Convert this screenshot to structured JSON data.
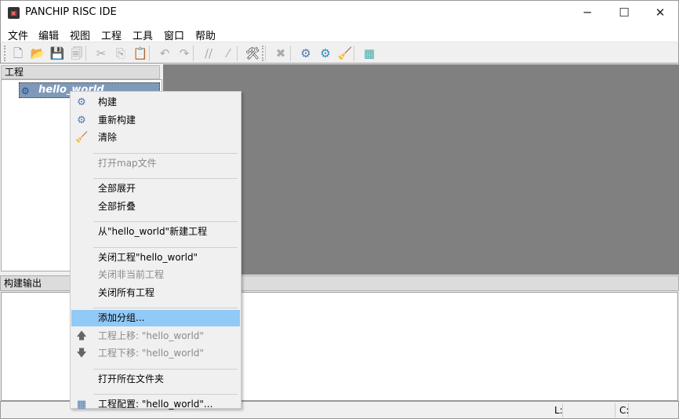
{
  "window": {
    "title": "PANCHIP RISC IDE",
    "minimize": "─",
    "maximize": "☐",
    "close": "✕"
  },
  "menubar": [
    "文件",
    "编辑",
    "视图",
    "工程",
    "工具",
    "窗口",
    "帮助"
  ],
  "toolbar": [
    {
      "name": "new-file-icon",
      "glyph": "🗋",
      "color": "#777"
    },
    {
      "name": "open-folder-icon",
      "glyph": "📂",
      "color": "#e8b400"
    },
    {
      "name": "save-icon",
      "glyph": "💾",
      "color": "#999"
    },
    {
      "name": "save-all-icon",
      "glyph": "🗐",
      "color": "#999"
    },
    {
      "name": "cut-icon",
      "glyph": "✂",
      "color": "#aaa"
    },
    {
      "name": "copy-icon",
      "glyph": "⎘",
      "color": "#aaa"
    },
    {
      "name": "paste-icon",
      "glyph": "📋",
      "color": "#aaa"
    },
    {
      "name": "undo-icon",
      "glyph": "↶",
      "color": "#aaa"
    },
    {
      "name": "redo-icon",
      "glyph": "↷",
      "color": "#aaa"
    },
    {
      "name": "comment-icon",
      "glyph": "//",
      "color": "#aaa"
    },
    {
      "name": "uncomment-icon",
      "glyph": "⁄",
      "color": "#aaa"
    },
    {
      "name": "tools-icon",
      "glyph": "🛠",
      "color": "#333"
    },
    {
      "name": "stop-icon",
      "glyph": "✖",
      "color": "#aaa"
    },
    {
      "name": "build-icon",
      "glyph": "⚙",
      "color": "#4a7ab0"
    },
    {
      "name": "rebuild-icon",
      "glyph": "⚙",
      "color": "#2a8ab0"
    },
    {
      "name": "clean-icon",
      "glyph": "🧹",
      "color": "#c08050"
    },
    {
      "name": "project-config-icon",
      "glyph": "▦",
      "color": "#4aa"
    }
  ],
  "project_panel": {
    "title": "工程",
    "project": "hello_world"
  },
  "build_output": {
    "title": "构建输出"
  },
  "status": {
    "line_label": "L:",
    "col_label": "C:"
  },
  "context_menu": [
    {
      "label": "构建",
      "icon": "⚙",
      "icon_name": "build-icon",
      "enabled": true
    },
    {
      "label": "重新构建",
      "icon": "⚙",
      "icon_name": "rebuild-icon",
      "enabled": true
    },
    {
      "label": "清除",
      "icon": "🧹",
      "icon_name": "clean-icon",
      "enabled": true
    },
    {
      "sep": true
    },
    {
      "label": "打开map文件",
      "enabled": false
    },
    {
      "sep": true
    },
    {
      "label": "全部展开",
      "enabled": true
    },
    {
      "label": "全部折叠",
      "enabled": true
    },
    {
      "sep": true
    },
    {
      "label": "从\"hello_world\"新建工程",
      "enabled": true
    },
    {
      "sep": true
    },
    {
      "label": "关闭工程\"hello_world\"",
      "enabled": true
    },
    {
      "label": "关闭非当前工程",
      "enabled": false
    },
    {
      "label": "关闭所有工程",
      "enabled": true
    },
    {
      "sep": true
    },
    {
      "label": "添加分组...",
      "enabled": true,
      "highlighted": true
    },
    {
      "label": "工程上移: \"hello_world\"",
      "icon": "🡅",
      "icon_name": "arrow-up-icon",
      "enabled": false
    },
    {
      "label": "工程下移: \"hello_world\"",
      "icon": "🡇",
      "icon_name": "arrow-down-icon",
      "enabled": false
    },
    {
      "sep": true
    },
    {
      "label": "打开所在文件夹",
      "enabled": true
    },
    {
      "sep": true
    },
    {
      "label": "工程配置: \"hello_world\"...",
      "icon": "▦",
      "icon_name": "project-config-icon",
      "enabled": true
    }
  ]
}
